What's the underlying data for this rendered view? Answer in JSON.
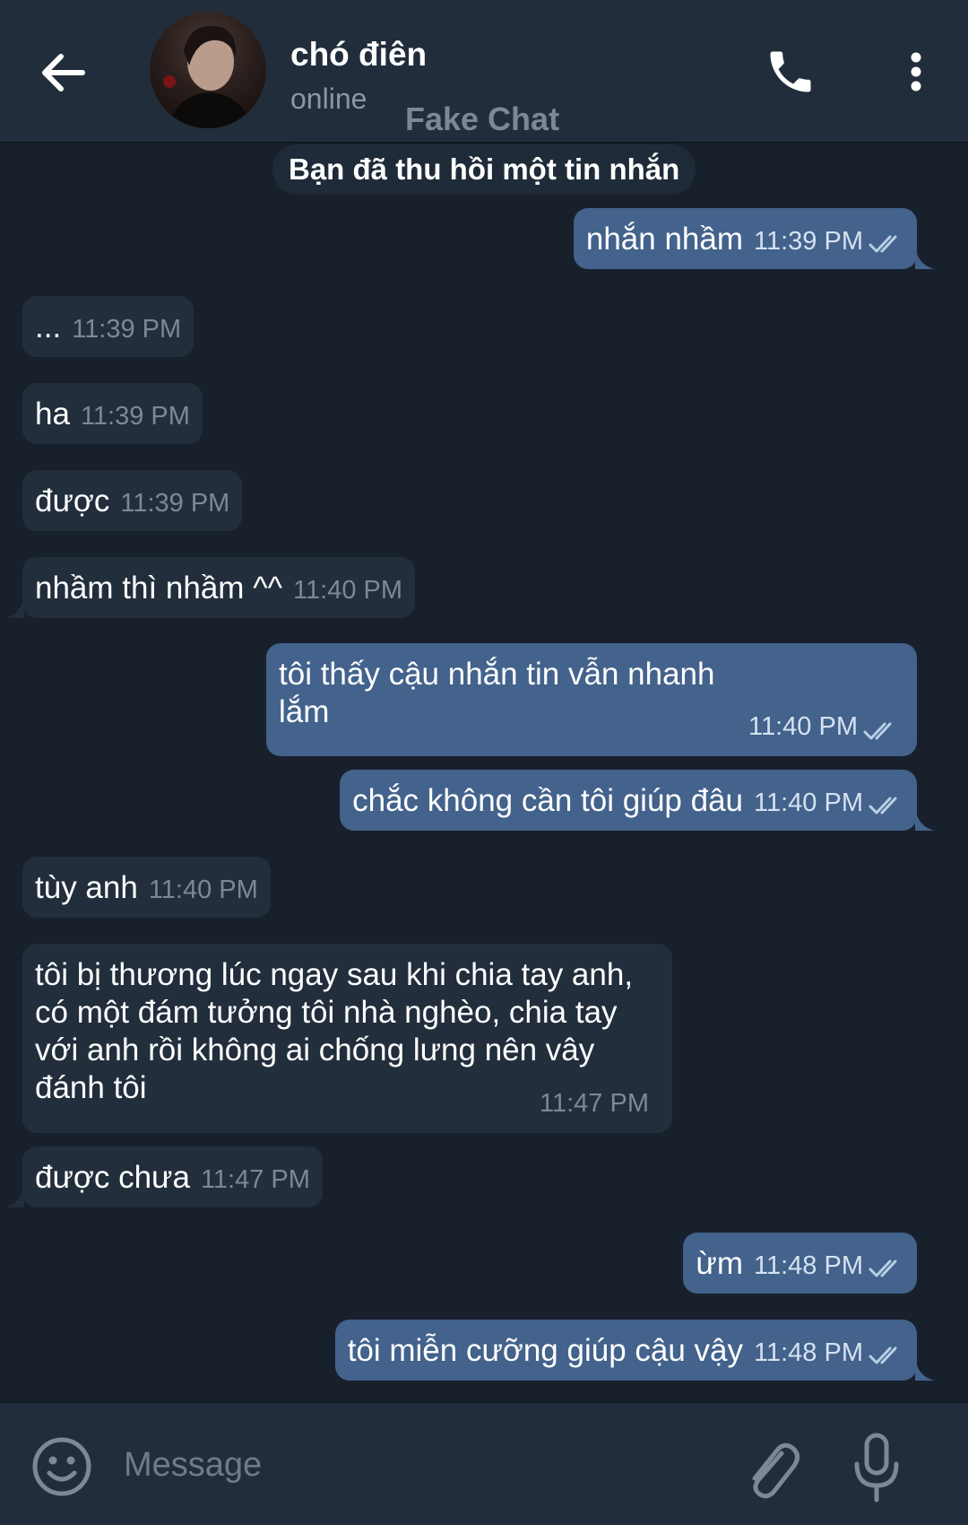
{
  "header": {
    "contact_name": "chó điên",
    "status": "online",
    "watermark": "Fake Chat"
  },
  "service_message": "Bạn đã thu hồi một tin nhắn",
  "messages": [
    {
      "dir": "out",
      "text": "nhắn nhầm",
      "time": "11:39 PM"
    },
    {
      "dir": "in",
      "text": "...",
      "time": "11:39 PM"
    },
    {
      "dir": "in",
      "text": "ha",
      "time": "11:39 PM"
    },
    {
      "dir": "in",
      "text": "được",
      "time": "11:39 PM"
    },
    {
      "dir": "in",
      "text": "nhầm thì nhầm ^^",
      "time": "11:40 PM"
    },
    {
      "dir": "out",
      "text": "tôi thấy cậu nhắn tin vẫn nhanh lắm",
      "time": "11:40 PM"
    },
    {
      "dir": "out",
      "text": "chắc không cần tôi giúp đâu",
      "time": "11:40 PM"
    },
    {
      "dir": "in",
      "text": "tùy anh",
      "time": "11:40 PM"
    },
    {
      "dir": "in",
      "text": "tôi bị thương lúc ngay sau khi chia tay anh, có một đám tưởng tôi nhà nghèo, chia tay với anh rồi không ai chống lưng nên vây đánh tôi",
      "time": "11:47 PM"
    },
    {
      "dir": "in",
      "text": "được chưa",
      "time": "11:47 PM"
    },
    {
      "dir": "out",
      "text": "ừm",
      "time": "11:48 PM"
    },
    {
      "dir": "out",
      "text": "tôi miễn cưỡng giúp cậu vậy",
      "time": "11:48 PM"
    }
  ],
  "composer": {
    "placeholder": "Message"
  },
  "icons": {
    "back": "arrow-left-icon",
    "call": "phone-icon",
    "menu": "more-vertical-icon",
    "emoji": "emoji-icon",
    "attach": "paperclip-icon",
    "mic": "microphone-icon",
    "read": "double-check-icon"
  },
  "colors": {
    "background": "#18202b",
    "header": "#212d3b",
    "incoming_bubble": "#222e3c",
    "outgoing_bubble": "#43628c"
  }
}
